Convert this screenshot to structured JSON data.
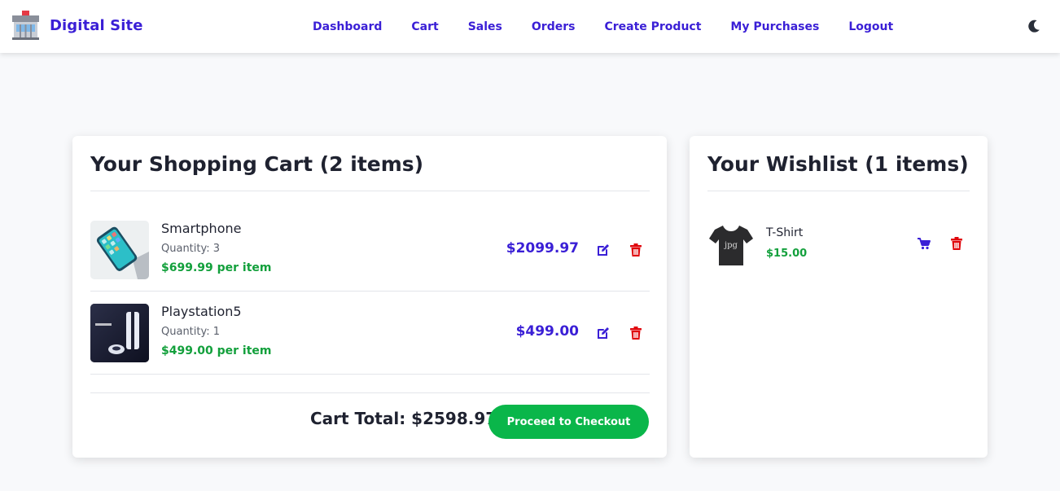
{
  "brand": {
    "name": "Digital Site",
    "logo_icon": "store-icon"
  },
  "nav": {
    "links": [
      {
        "label": "Dashboard"
      },
      {
        "label": "Cart"
      },
      {
        "label": "Sales"
      },
      {
        "label": "Orders"
      },
      {
        "label": "Create Product"
      },
      {
        "label": "My Purchases"
      },
      {
        "label": "Logout"
      }
    ],
    "theme_toggle_icon": "moon-icon"
  },
  "cart": {
    "title": "Your Shopping Cart (2 items)",
    "items": [
      {
        "name": "Smartphone",
        "quantity": "Quantity: 3",
        "unit_price": "$699.99 per item",
        "total": "$2099.97",
        "edit_icon": "edit-icon",
        "delete_icon": "trash-icon"
      },
      {
        "name": "Playstation5",
        "quantity": "Quantity: 1",
        "unit_price": "$499.00 per item",
        "total": "$499.00",
        "edit_icon": "edit-icon",
        "delete_icon": "trash-icon"
      }
    ],
    "total_label": "Cart Total: $2598.97",
    "checkout_label": "Proceed to Checkout"
  },
  "wishlist": {
    "title": "Your Wishlist (1 items)",
    "items": [
      {
        "name": "T-Shirt",
        "price": "$15.00",
        "image_text": "jpg",
        "move_icon": "cart-move-icon",
        "delete_icon": "trash-icon"
      }
    ]
  },
  "colors": {
    "accent": "#3a1fd6",
    "price_green": "#13a03c",
    "danger": "#e0060c",
    "checkout": "#0ab64a"
  }
}
